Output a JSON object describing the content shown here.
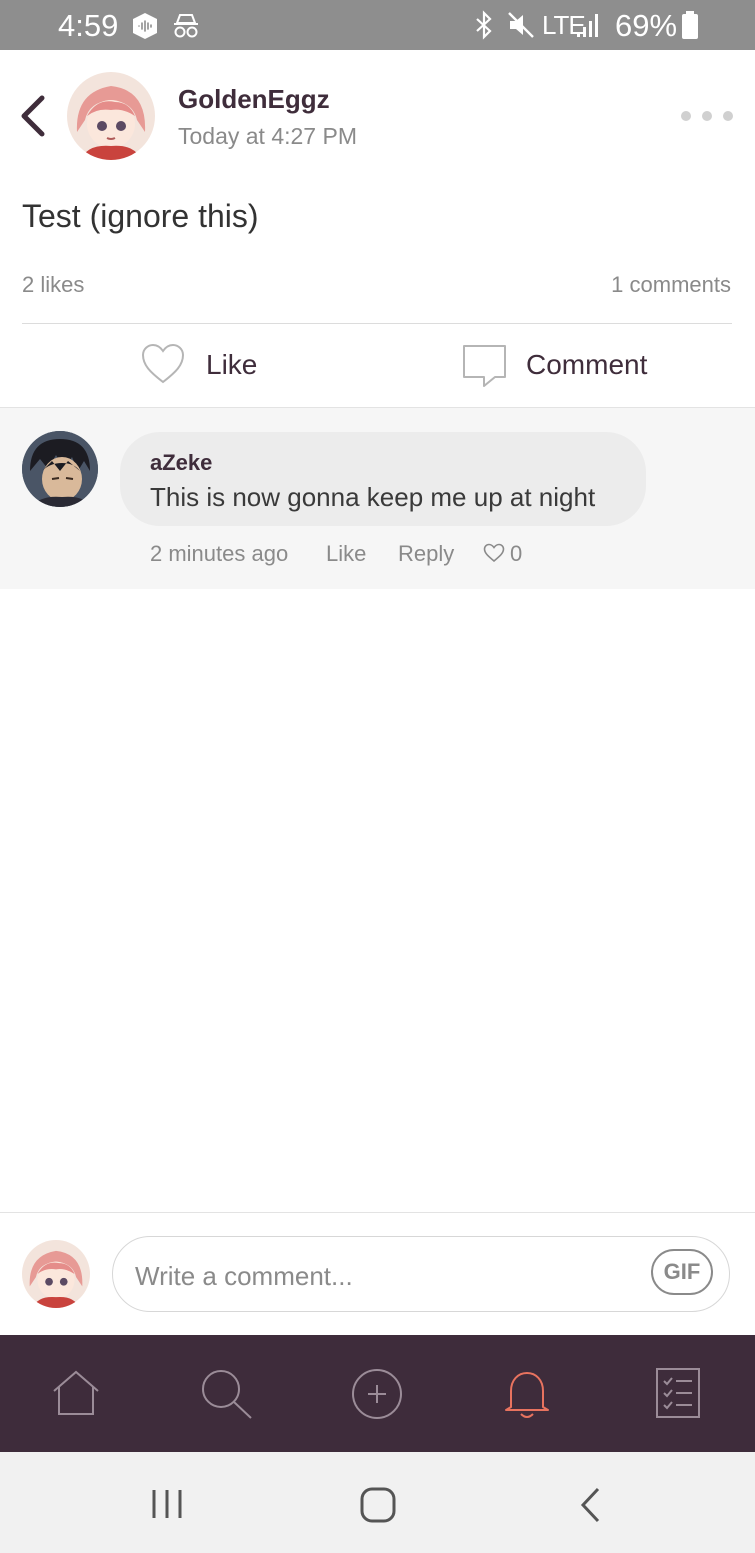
{
  "status_bar": {
    "time": "4:59",
    "network": "LTE",
    "battery": "69%"
  },
  "post": {
    "author": "GoldenEggz",
    "timestamp": "Today at 4:27 PM",
    "text": "Test (ignore this)",
    "likes": "2 likes",
    "comments": "1 comments"
  },
  "actions": {
    "like_label": "Like",
    "comment_label": "Comment"
  },
  "comments": [
    {
      "author": "aZeke",
      "text": "This is now gonna keep me up at night",
      "time": "2 minutes ago",
      "like_label": "Like",
      "reply_label": "Reply",
      "heart_count": "0"
    }
  ],
  "composer": {
    "placeholder": "Write a comment...",
    "gif_label": "GIF"
  },
  "colors": {
    "tab_bar": "#3e2c3b",
    "active_tab": "#e8735f",
    "status_bar": "#8e8e8e"
  },
  "tab_bar": {
    "items": [
      "home-icon",
      "search-icon",
      "create-icon",
      "notifications-icon",
      "checklist-icon"
    ],
    "active": "notifications-icon"
  }
}
